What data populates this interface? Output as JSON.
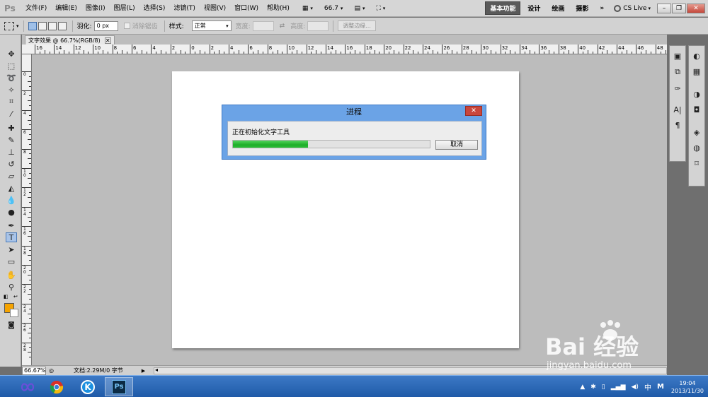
{
  "app": {
    "logo": "Ps"
  },
  "menubar": {
    "items": [
      "文件(F)",
      "编辑(E)",
      "图像(I)",
      "图层(L)",
      "选择(S)",
      "滤镜(T)",
      "视图(V)",
      "窗口(W)",
      "帮助(H)"
    ],
    "zoom": "66.7",
    "workspaces": [
      "基本功能",
      "设计",
      "绘画",
      "摄影"
    ],
    "more": "»",
    "cslive": "CS Live"
  },
  "options": {
    "feather_label": "羽化:",
    "feather_value": "0 px",
    "antialias_label": "消除锯齿",
    "style_label": "样式:",
    "style_value": "正常",
    "width_label": "宽度:",
    "height_label": "高度:",
    "refine_button": "调整边缘..."
  },
  "document": {
    "tab_title": "文字效果 @ 66.7%(RGB/8)",
    "zoom_status": "66.67%",
    "doc_size": "文档:2.29M/0 字节"
  },
  "ruler": {
    "h_labels": [
      "16",
      "14",
      "12",
      "10",
      "8",
      "6",
      "4",
      "2",
      "0",
      "2",
      "4",
      "6",
      "8",
      "10",
      "12",
      "14",
      "16",
      "18",
      "20",
      "22",
      "24",
      "26",
      "28",
      "30",
      "32",
      "34",
      "36",
      "38",
      "40",
      "42",
      "44",
      "46",
      "48"
    ],
    "v_labels": [
      "0",
      "2",
      "4",
      "6",
      "8",
      "10",
      "12",
      "14",
      "16",
      "18",
      "20",
      "22",
      "24",
      "26",
      "28"
    ]
  },
  "dialog": {
    "title": "进程",
    "message": "正在初始化文字工具",
    "progress": 0.38,
    "cancel": "取消",
    "close": "✕"
  },
  "taskbar": {
    "apps": [
      "chrome",
      "kugou",
      "photoshop"
    ],
    "ps_label": "Ps",
    "ime": "中",
    "ime2": "M",
    "time": "19:04",
    "date": "2013/11/30"
  },
  "watermark": {
    "text1": "Bai 经验",
    "text2": "jingyan.baidu.com"
  },
  "colors": {
    "foreground": "#f5a300",
    "dialog_frame": "#6ba3e6",
    "progress": "#1fae2a"
  }
}
